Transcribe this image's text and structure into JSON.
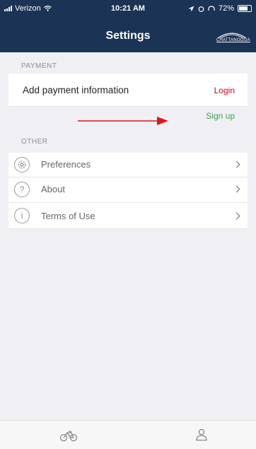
{
  "status_bar": {
    "carrier": "Verizon",
    "time": "10:21 AM",
    "battery": "72%"
  },
  "header": {
    "title": "Settings",
    "logo_text": "CHATTANOOGA"
  },
  "payment": {
    "section_label": "PAYMENT",
    "row_label": "Add payment information",
    "login_label": "Login",
    "signup_label": "Sign up"
  },
  "other": {
    "section_label": "OTHER",
    "items": [
      {
        "label": "Preferences",
        "icon": "gear-icon"
      },
      {
        "label": "About",
        "icon": "question-icon"
      },
      {
        "label": "Terms of Use",
        "icon": "info-icon"
      }
    ]
  },
  "tabs": [
    {
      "icon": "bike-icon"
    },
    {
      "icon": "profile-icon"
    }
  ],
  "colors": {
    "header_bg": "#1b3354",
    "login": "#d0021b",
    "signup": "#3aa655",
    "arrow": "#e0161b"
  }
}
